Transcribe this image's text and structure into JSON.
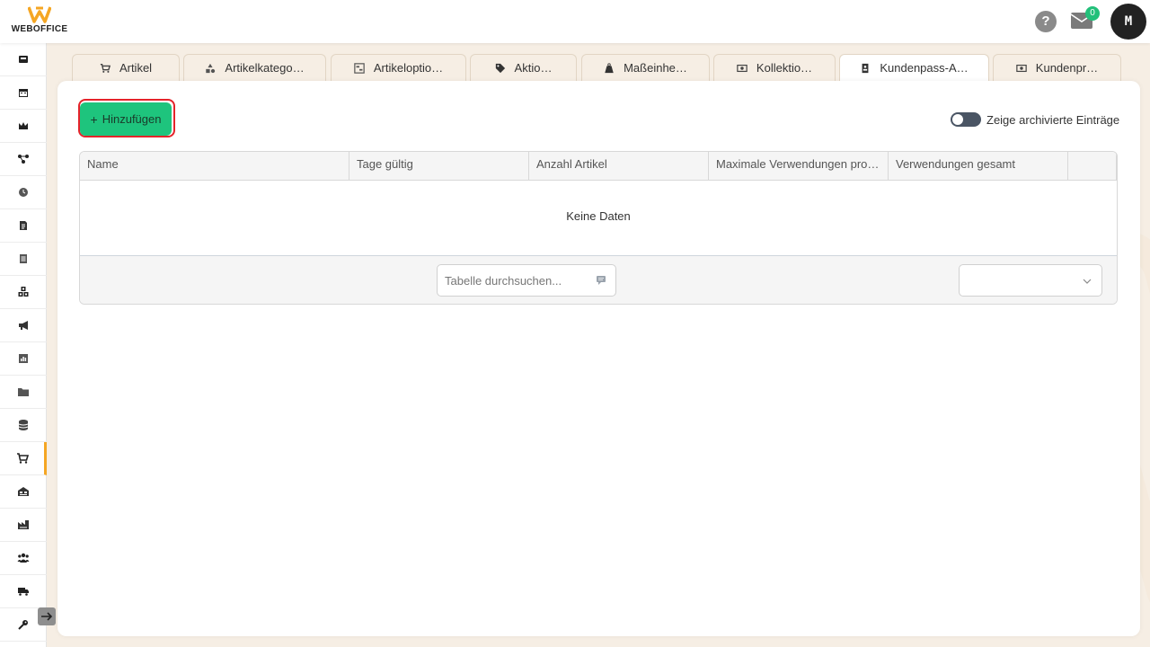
{
  "brand": {
    "name": "WEBOFFICE",
    "accent": "#f5a623"
  },
  "header": {
    "help_label": "?",
    "mail_badge": "0",
    "avatar_initial": "M"
  },
  "sidebar": {
    "items": [
      {
        "icon": "pos-register-icon"
      },
      {
        "icon": "calendar-icon"
      },
      {
        "icon": "crown-icon"
      },
      {
        "icon": "network-icon"
      },
      {
        "icon": "clock-icon"
      },
      {
        "icon": "document-icon"
      },
      {
        "icon": "list-document-icon"
      },
      {
        "icon": "boxes-icon"
      },
      {
        "icon": "megaphone-icon"
      },
      {
        "icon": "report-chart-icon"
      },
      {
        "icon": "folder-icon"
      },
      {
        "icon": "database-icon"
      },
      {
        "icon": "shopping-cart-icon",
        "active": true
      },
      {
        "icon": "warehouse-icon"
      },
      {
        "icon": "factory-icon"
      },
      {
        "icon": "users-icon"
      },
      {
        "icon": "delivery-truck-icon"
      },
      {
        "icon": "key-icon"
      }
    ]
  },
  "tabs": [
    {
      "label": "Artikel",
      "icon": "shopping-cart-icon"
    },
    {
      "label": "Artikelkatego…",
      "icon": "shapes-icon"
    },
    {
      "label": "Artikeloptio…",
      "icon": "sliders-icon"
    },
    {
      "label": "Aktio…",
      "icon": "tag-icon"
    },
    {
      "label": "Maßeinhe…",
      "icon": "weight-icon"
    },
    {
      "label": "Kollektio…",
      "icon": "collection-icon"
    },
    {
      "label": "Kundenpass-A…",
      "icon": "id-card-icon",
      "active": true
    },
    {
      "label": "Kundenpr…",
      "icon": "money-icon"
    }
  ],
  "toolbar": {
    "add_label": "Hinzufügen",
    "archive_toggle_label": "Zeige archivierte Einträge",
    "archive_toggle_on": false
  },
  "table": {
    "columns": [
      "Name",
      "Tage gültig",
      "Anzahl Artikel",
      "Maximale Verwendungen pro…",
      "Verwendungen gesamt",
      ""
    ],
    "rows": [],
    "empty_text": "Keine Daten",
    "search_placeholder": "Tabelle durchsuchen...",
    "page_size_value": ""
  },
  "colors": {
    "add_button": "#1ec47d",
    "highlight_border": "#e5232a",
    "badge": "#22c07a"
  }
}
